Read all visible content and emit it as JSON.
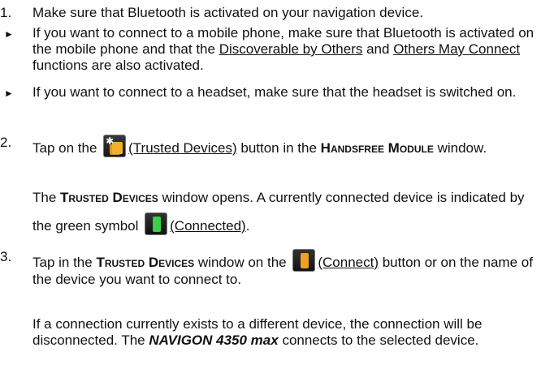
{
  "steps": [
    {
      "number": "1.",
      "text": "Make sure that Bluetooth is activated on your navigation device."
    },
    {
      "bullet": "►",
      "text_a": "If you want to connect to a mobile phone, make sure that Bluetooth is activated on the mobile phone and that the ",
      "link_a": "Discoverable by Others",
      "text_b": " and ",
      "link_b": "Others May Connect",
      "text_c": " functions are also activated."
    },
    {
      "bullet": "►",
      "text": "If you want to connect to a headset, make sure that the headset is switched on."
    },
    {
      "number": "2.",
      "text_a": "Tap on the ",
      "link": "(Trusted Devices)",
      "text_b": " button in the ",
      "window": "Handsfree Module",
      "text_c": " window.",
      "result_a": "The ",
      "result_window": "Trusted Devices",
      "result_b": " window opens. A currently connected device is indicated by the green symbol ",
      "result_link": "(Connected)",
      "result_c": "."
    },
    {
      "number": "3.",
      "text_a": "Tap in the ",
      "window": "Trusted Devices",
      "text_b": " window on the ",
      "link": "(Connect)",
      "text_c": " button or on the name of the device you want to connect to.",
      "result_a": "If a connection currently exists to a different device, the connection will be disconnected. The ",
      "product": "NAVIGON 4350 max",
      "result_b": " connects to the selected device."
    }
  ],
  "icons": {
    "trusted_devices": "trusted-devices-icon",
    "connected": "green-phone-icon",
    "connect": "orange-phone-icon"
  }
}
